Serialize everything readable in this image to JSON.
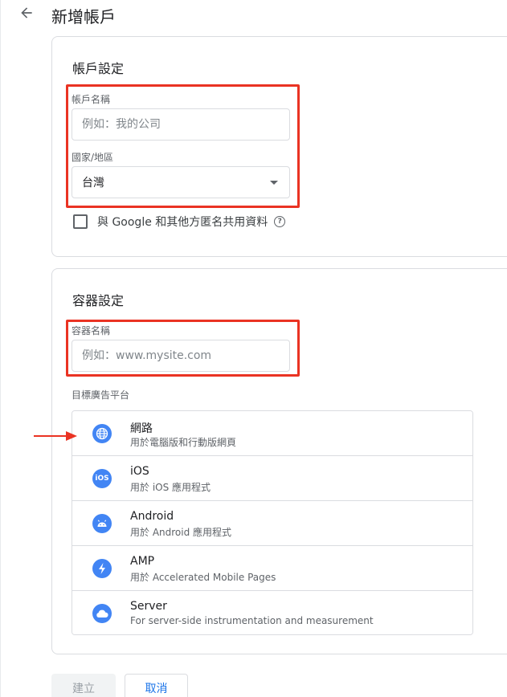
{
  "header": {
    "title": "新增帳戶",
    "back_icon": "arrow-back-icon"
  },
  "account_settings": {
    "title": "帳戶設定",
    "account_name_label": "帳戶名稱",
    "account_name_placeholder": "例如：我的公司",
    "account_name_value": "",
    "country_label": "國家/地區",
    "country_value": "台灣",
    "share_data_label": "與 Google 和其他方匿名共用資料",
    "share_data_checked": false
  },
  "container_settings": {
    "title": "容器設定",
    "container_name_label": "容器名稱",
    "container_name_placeholder": "例如：www.mysite.com",
    "container_name_value": "",
    "target_platform_label": "目標廣告平台",
    "platforms": [
      {
        "name": "網路",
        "description": "用於電腦版和行動版網頁",
        "icon": "globe-icon"
      },
      {
        "name": "iOS",
        "description": "用於 iOS 應用程式",
        "icon": "ios-icon"
      },
      {
        "name": "Android",
        "description": "用於 Android 應用程式",
        "icon": "android-icon"
      },
      {
        "name": "AMP",
        "description": "用於 Accelerated Mobile Pages",
        "icon": "bolt-icon"
      },
      {
        "name": "Server",
        "description": "For server-side instrumentation and measurement",
        "icon": "cloud-icon"
      }
    ]
  },
  "actions": {
    "create_label": "建立",
    "cancel_label": "取消"
  },
  "colors": {
    "accent": "#1a73e8",
    "icon_blue": "#4285f4",
    "highlight": "#ea3323",
    "border": "#dadce0"
  }
}
